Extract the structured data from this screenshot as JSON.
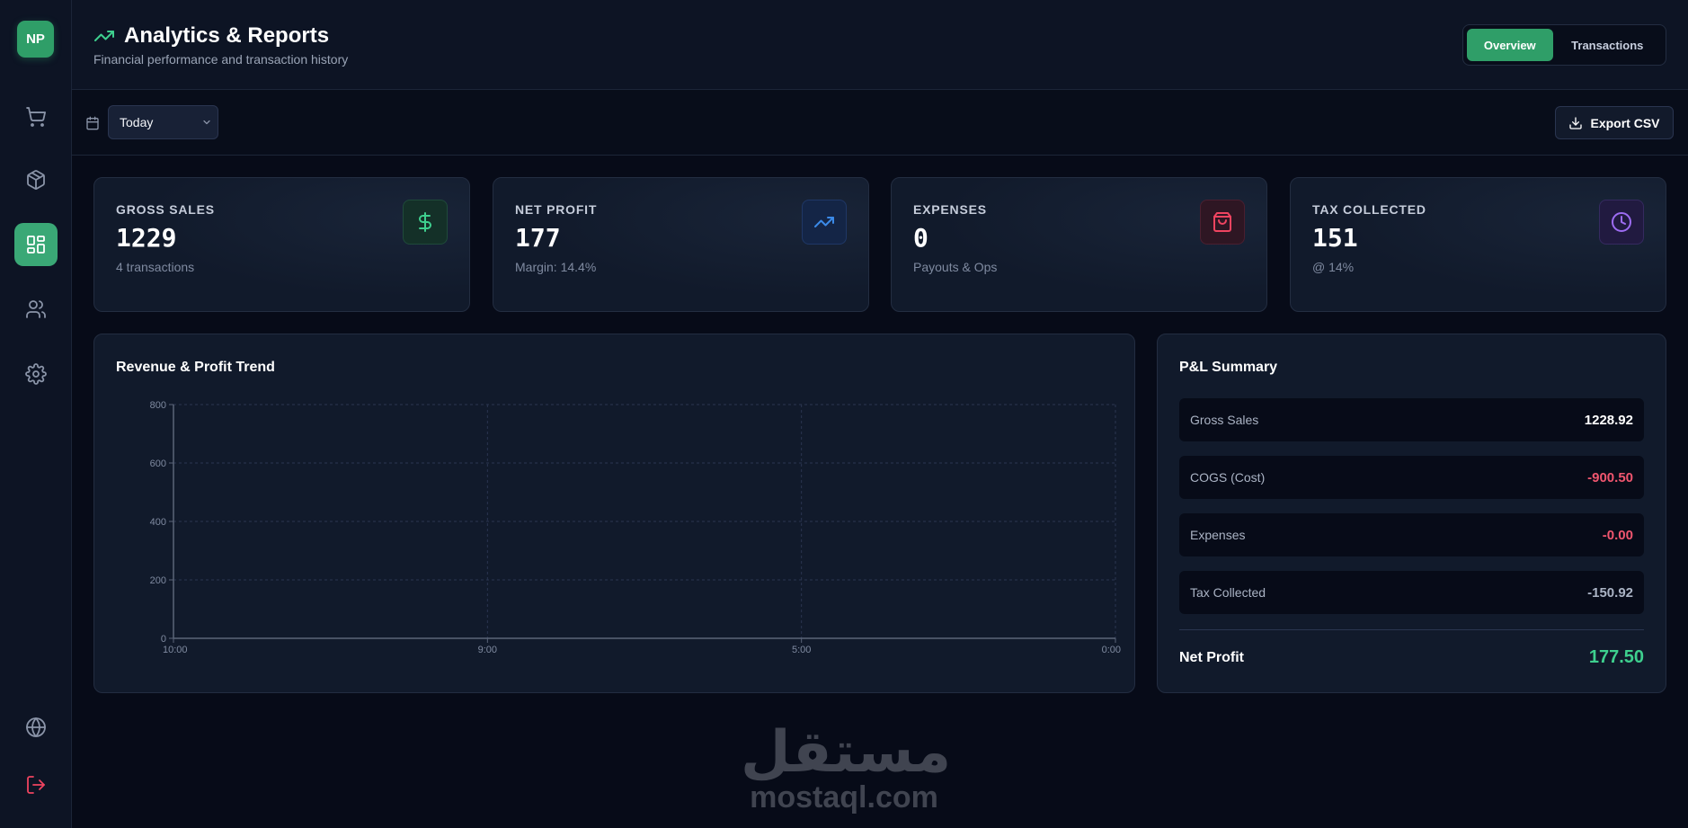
{
  "sidebar": {
    "avatar": "NP",
    "items": [
      {
        "name": "cart-icon"
      },
      {
        "name": "box-icon"
      },
      {
        "name": "dashboard-icon",
        "active": true
      },
      {
        "name": "users-icon"
      },
      {
        "name": "settings-icon"
      }
    ],
    "bottom": [
      {
        "name": "globe-icon"
      },
      {
        "name": "logout-icon"
      }
    ]
  },
  "header": {
    "title": "Analytics & Reports",
    "subtitle": "Financial performance and transaction history",
    "tabs": [
      {
        "label": "Overview",
        "active": true
      },
      {
        "label": "Transactions",
        "active": false
      }
    ]
  },
  "toolbar": {
    "date_range": "Today",
    "export_label": "Export CSV"
  },
  "stats": [
    {
      "label": "GROSS SALES",
      "value": "1229",
      "sub": "4 transactions",
      "icon": "dollar-icon",
      "color": "#3ecf8e"
    },
    {
      "label": "NET PROFIT",
      "value": "177",
      "sub": "Margin: 14.4%",
      "icon": "trending-up-icon",
      "color": "#3b8ae8"
    },
    {
      "label": "EXPENSES",
      "value": "0",
      "sub": "Payouts & Ops",
      "icon": "shopping-bag-icon",
      "color": "#ef4460"
    },
    {
      "label": "TAX COLLECTED",
      "value": "151",
      "sub": "@ 14%",
      "icon": "clock-icon",
      "color": "#9d6cf2"
    }
  ],
  "chart": {
    "title": "Revenue & Profit Trend"
  },
  "chart_data": {
    "type": "line",
    "title": "Revenue & Profit Trend",
    "x": [
      "10:00",
      "9:00",
      "5:00",
      "0:00"
    ],
    "yticks": [
      0,
      200,
      400,
      600,
      800
    ],
    "ylim": [
      0,
      800
    ],
    "grid": true,
    "series": []
  },
  "pl": {
    "title": "P&L Summary",
    "rows": [
      {
        "label": "Gross Sales",
        "value": "1228.92",
        "color": "#ffffff"
      },
      {
        "label": "COGS (Cost)",
        "value": "-900.50",
        "color": "#f0566f"
      },
      {
        "label": "Expenses",
        "value": "-0.00",
        "color": "#f0566f"
      },
      {
        "label": "Tax Collected",
        "value": "-150.92",
        "color": "#aab3c4"
      }
    ],
    "net_label": "Net Profit",
    "net_value": "177.50"
  },
  "watermark": {
    "arabic": "مستقل",
    "latin": "mostaql.com"
  }
}
